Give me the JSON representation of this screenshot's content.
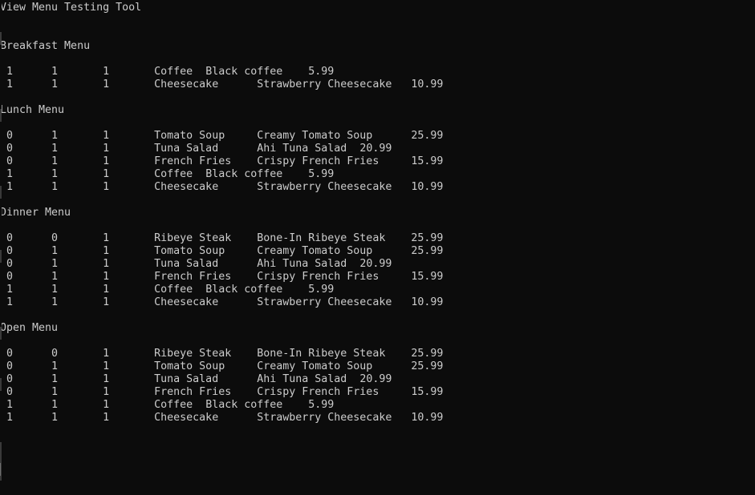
{
  "terminal": {
    "title": "View Menu Testing Tool",
    "background_color": "#0c0c0c",
    "foreground_color": "#cccccc",
    "columns": 117,
    "rows": 38
  },
  "columns_legend": [
    "flag_1",
    "flag_2",
    "flag_3",
    "item_name",
    "item_description",
    "price"
  ],
  "sections": [
    {
      "heading": "Breakfast Menu",
      "rows": [
        {
          "flag_1": "1",
          "flag_2": "1",
          "flag_3": "1",
          "name": "Coffee",
          "description": "Black coffee",
          "price": "5.99"
        },
        {
          "flag_1": "1",
          "flag_2": "1",
          "flag_3": "1",
          "name": "Cheesecake",
          "description": "Strawberry Cheesecake",
          "price": "10.99"
        }
      ]
    },
    {
      "heading": "Lunch Menu",
      "rows": [
        {
          "flag_1": "0",
          "flag_2": "1",
          "flag_3": "1",
          "name": "Tomato Soup",
          "description": "Creamy Tomato Soup",
          "price": "25.99"
        },
        {
          "flag_1": "0",
          "flag_2": "1",
          "flag_3": "1",
          "name": "Tuna Salad",
          "description": "Ahi Tuna Salad",
          "price": "20.99"
        },
        {
          "flag_1": "0",
          "flag_2": "1",
          "flag_3": "1",
          "name": "French Fries",
          "description": "Crispy French Fries",
          "price": "15.99"
        },
        {
          "flag_1": "1",
          "flag_2": "1",
          "flag_3": "1",
          "name": "Coffee",
          "description": "Black coffee",
          "price": "5.99"
        },
        {
          "flag_1": "1",
          "flag_2": "1",
          "flag_3": "1",
          "name": "Cheesecake",
          "description": "Strawberry Cheesecake",
          "price": "10.99"
        }
      ]
    },
    {
      "heading": "Dinner Menu",
      "rows": [
        {
          "flag_1": "0",
          "flag_2": "0",
          "flag_3": "1",
          "name": "Ribeye Steak",
          "description": "Bone-In Ribeye Steak",
          "price": "25.99"
        },
        {
          "flag_1": "0",
          "flag_2": "1",
          "flag_3": "1",
          "name": "Tomato Soup",
          "description": "Creamy Tomato Soup",
          "price": "25.99"
        },
        {
          "flag_1": "0",
          "flag_2": "1",
          "flag_3": "1",
          "name": "Tuna Salad",
          "description": "Ahi Tuna Salad",
          "price": "20.99"
        },
        {
          "flag_1": "0",
          "flag_2": "1",
          "flag_3": "1",
          "name": "French Fries",
          "description": "Crispy French Fries",
          "price": "15.99"
        },
        {
          "flag_1": "1",
          "flag_2": "1",
          "flag_3": "1",
          "name": "Coffee",
          "description": "Black coffee",
          "price": "5.99"
        },
        {
          "flag_1": "1",
          "flag_2": "1",
          "flag_3": "1",
          "name": "Cheesecake",
          "description": "Strawberry Cheesecake",
          "price": "10.99"
        }
      ]
    },
    {
      "heading": "Open Menu",
      "rows": [
        {
          "flag_1": "0",
          "flag_2": "0",
          "flag_3": "1",
          "name": "Ribeye Steak",
          "description": "Bone-In Ribeye Steak",
          "price": "25.99"
        },
        {
          "flag_1": "0",
          "flag_2": "1",
          "flag_3": "1",
          "name": "Tomato Soup",
          "description": "Creamy Tomato Soup",
          "price": "25.99"
        },
        {
          "flag_1": "0",
          "flag_2": "1",
          "flag_3": "1",
          "name": "Tuna Salad",
          "description": "Ahi Tuna Salad",
          "price": "20.99"
        },
        {
          "flag_1": "0",
          "flag_2": "1",
          "flag_3": "1",
          "name": "French Fries",
          "description": "Crispy French Fries",
          "price": "15.99"
        },
        {
          "flag_1": "1",
          "flag_2": "1",
          "flag_3": "1",
          "name": "Coffee",
          "description": "Black coffee",
          "price": "5.99"
        },
        {
          "flag_1": "1",
          "flag_2": "1",
          "flag_3": "1",
          "name": "Cheesecake",
          "description": "Strawberry Cheesecake",
          "price": "10.99"
        }
      ]
    }
  ]
}
